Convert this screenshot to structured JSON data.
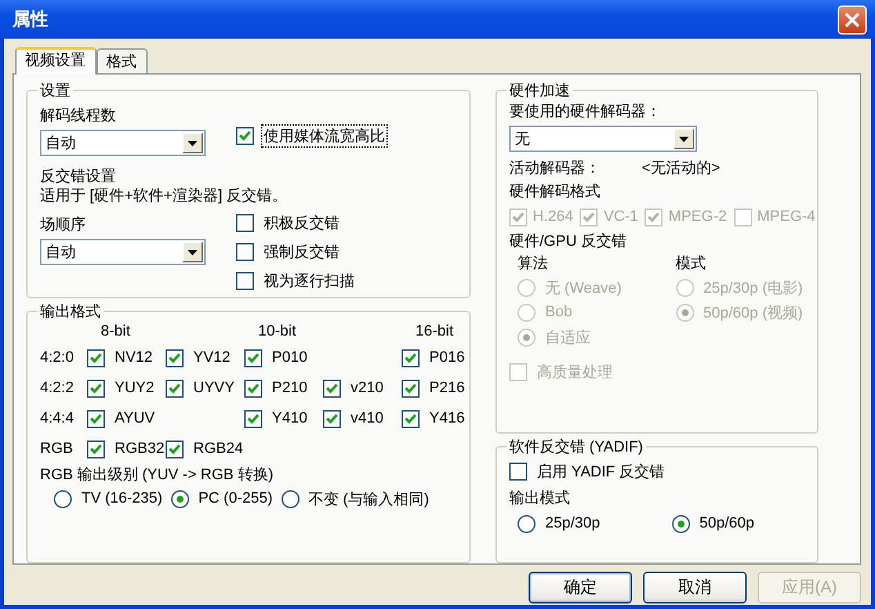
{
  "window": {
    "title": "属性"
  },
  "tabs": [
    {
      "label": "视频设置",
      "selected": true
    },
    {
      "label": "格式",
      "selected": false
    }
  ],
  "settings": {
    "title": "设置",
    "thread_label": "解码线程数",
    "thread_value": "自动",
    "aspect": {
      "label": "使用媒体流宽高比",
      "checked": true,
      "focused": true
    },
    "deint_heading": "反交错设置",
    "deint_note": "适用于 [硬件+软件+渲染器] 反交错。",
    "field_order_label": "场顺序",
    "field_order_value": "自动",
    "options": [
      {
        "label": "积极反交错",
        "checked": false
      },
      {
        "label": "强制反交错",
        "checked": false
      },
      {
        "label": "视为逐行扫描",
        "checked": false
      }
    ]
  },
  "output_format": {
    "title": "输出格式",
    "headers": [
      "8-bit",
      "10-bit",
      "16-bit"
    ],
    "rows": [
      {
        "label": "4:2:0",
        "cells": [
          {
            "label": "NV12",
            "checked": true
          },
          {
            "label": "YV12",
            "checked": true
          },
          {
            "label": "P010",
            "checked": true
          },
          null,
          {
            "label": "P016",
            "checked": true
          }
        ]
      },
      {
        "label": "4:2:2",
        "cells": [
          {
            "label": "YUY2",
            "checked": true
          },
          {
            "label": "UYVY",
            "checked": true
          },
          {
            "label": "P210",
            "checked": true
          },
          {
            "label": "v210",
            "checked": true
          },
          {
            "label": "P216",
            "checked": true
          }
        ]
      },
      {
        "label": "4:4:4",
        "cells": [
          {
            "label": "AYUV",
            "checked": true
          },
          null,
          {
            "label": "Y410",
            "checked": true
          },
          {
            "label": "v410",
            "checked": true
          },
          {
            "label": "Y416",
            "checked": true
          }
        ]
      },
      {
        "label": "RGB",
        "cells": [
          {
            "label": "RGB32",
            "checked": true
          },
          {
            "label": "RGB24",
            "checked": true
          },
          null,
          null,
          null
        ]
      }
    ],
    "rgb_level_label": "RGB 输出级别 (YUV -> RGB 转换)",
    "rgb_levels": [
      {
        "label": "TV (16-235)",
        "selected": false
      },
      {
        "label": "PC (0-255)",
        "selected": true
      },
      {
        "label": "不变 (与输入相同)",
        "selected": false
      }
    ]
  },
  "hardware": {
    "title": "硬件加速",
    "decoder_label": "要使用的硬件解码器：",
    "decoder_value": "无",
    "active_label": "活动解码器：",
    "active_value": "<无活动的>",
    "formats_label": "硬件解码格式",
    "formats": [
      {
        "label": "H.264",
        "checked": true,
        "disabled": true
      },
      {
        "label": "VC-1",
        "checked": true,
        "disabled": true
      },
      {
        "label": "MPEG-2",
        "checked": true,
        "disabled": true
      },
      {
        "label": "MPEG-4",
        "checked": false,
        "disabled": true
      }
    ],
    "gpu_label": "硬件/GPU 反交错",
    "algorithm": {
      "title": "算法",
      "options": [
        {
          "label": "无 (Weave)",
          "selected": false,
          "disabled": true
        },
        {
          "label": "Bob",
          "selected": false,
          "disabled": true
        },
        {
          "label": "自适应",
          "selected": true,
          "disabled": true
        }
      ]
    },
    "mode": {
      "title": "模式",
      "options": [
        {
          "label": "25p/30p (电影)",
          "selected": false,
          "disabled": true
        },
        {
          "label": "50p/60p (视频)",
          "selected": true,
          "disabled": true
        }
      ]
    },
    "hq": {
      "label": "高质量处理",
      "checked": false,
      "disabled": true
    }
  },
  "yadif": {
    "title": "软件反交错 (YADIF)",
    "enable": {
      "label": "启用 YADIF 反交错",
      "checked": false
    },
    "output_mode_label": "输出模式",
    "modes": [
      {
        "label": "25p/30p",
        "selected": false
      },
      {
        "label": "50p/60p",
        "selected": true
      }
    ]
  },
  "buttons": [
    {
      "label": "确定",
      "default": true,
      "disabled": false
    },
    {
      "label": "取消",
      "default": false,
      "disabled": false
    },
    {
      "label": "应用(A)",
      "default": false,
      "disabled": true
    }
  ]
}
